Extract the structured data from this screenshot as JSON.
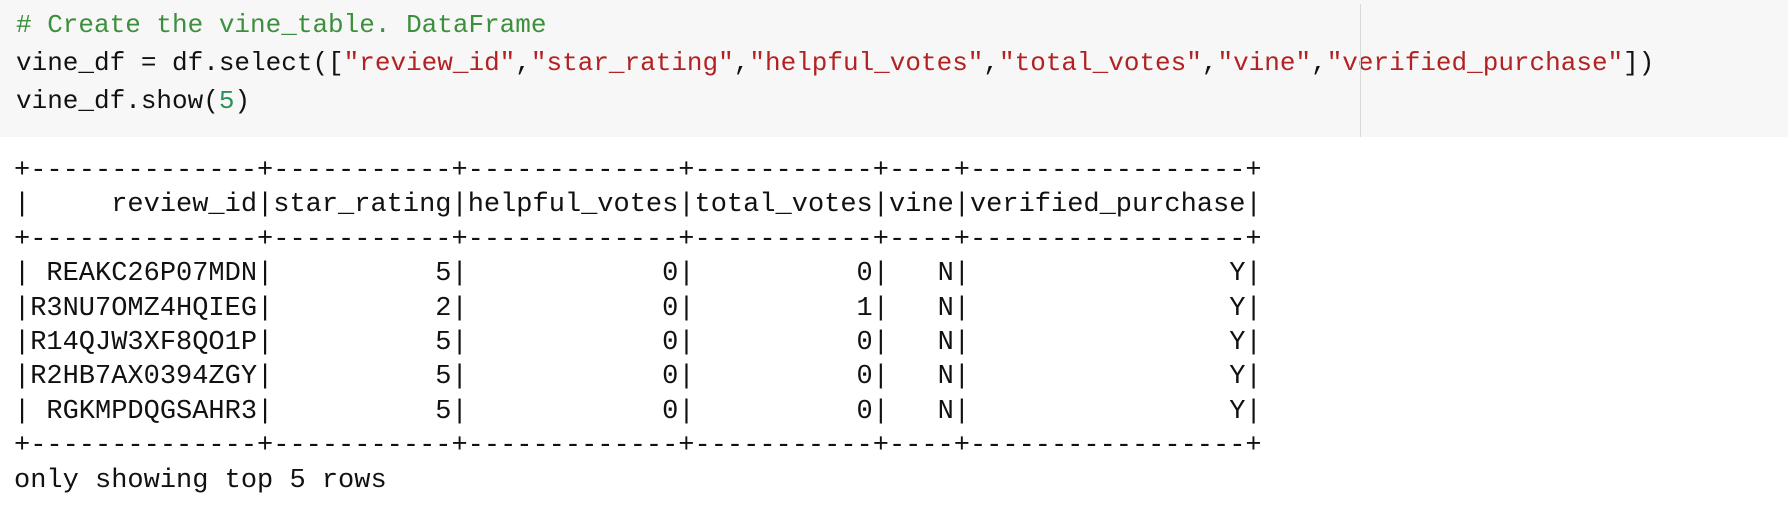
{
  "code_cell": {
    "comment": "# Create the vine_table. DataFrame",
    "line2_prefix": "vine_df = df.select([",
    "line2_args": [
      "\"review_id\"",
      "\"star_rating\"",
      "\"helpful_votes\"",
      "\"total_votes\"",
      "\"vine\"",
      "\"verified_purchase\""
    ],
    "line2_sep": ",",
    "line2_suffix": "])",
    "line3_prefix": "vine_df.show(",
    "line3_arg": "5",
    "line3_suffix": ")"
  },
  "output": {
    "columns": [
      "review_id",
      "star_rating",
      "helpful_votes",
      "total_votes",
      "vine",
      "verified_purchase"
    ],
    "rows": [
      [
        "REAKC26P07MDN",
        "5",
        "0",
        "0",
        "N",
        "Y"
      ],
      [
        "R3NU7OMZ4HQIEG",
        "2",
        "0",
        "1",
        "N",
        "Y"
      ],
      [
        "R14QJW3XF8QO1P",
        "5",
        "0",
        "0",
        "N",
        "Y"
      ],
      [
        "R2HB7AX0394ZGY",
        "5",
        "0",
        "0",
        "N",
        "Y"
      ],
      [
        "RGKMPDQGSAHR3",
        "5",
        "0",
        "0",
        "N",
        "Y"
      ]
    ],
    "footer": "only showing top 5 rows"
  },
  "colors": {
    "cell_background": "#f7f7f7",
    "comment": "#3c8f3c",
    "string": "#b22222",
    "number": "#2f8f5b"
  }
}
